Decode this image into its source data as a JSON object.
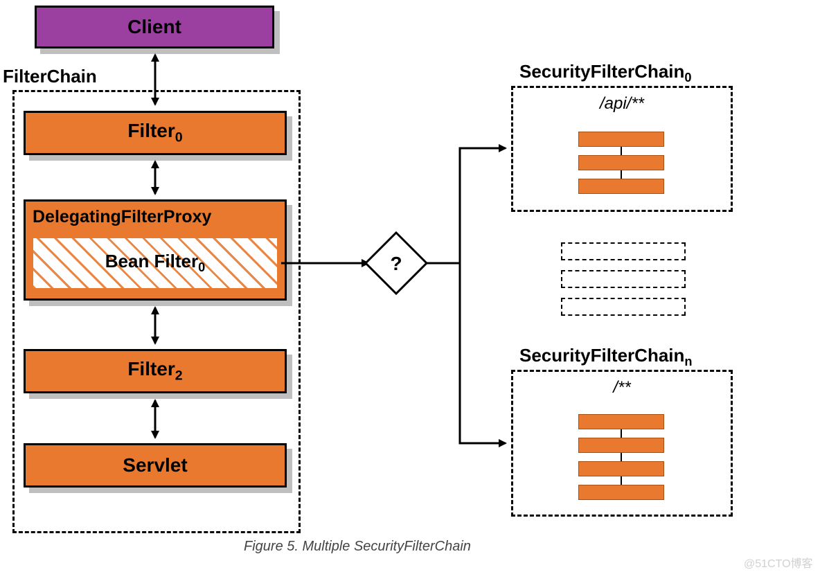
{
  "client": {
    "label": "Client"
  },
  "filterchain": {
    "title": "FilterChain",
    "filter0": "Filter",
    "filter0_sub": "0",
    "delegating": "DelegatingFilterProxy",
    "bean": "Bean Filter",
    "bean_sub": "0",
    "filter2": "Filter",
    "filter2_sub": "2",
    "servlet": "Servlet"
  },
  "decision": "?",
  "sfc": {
    "title0": "SecurityFilterChain",
    "title0_sub": "0",
    "path0": "/api/**",
    "titleN": "SecurityFilterChain",
    "titleN_sub": "n",
    "pathN": "/**"
  },
  "caption": "Figure 5. Multiple SecurityFilterChain",
  "watermark": "@51CTO博客"
}
